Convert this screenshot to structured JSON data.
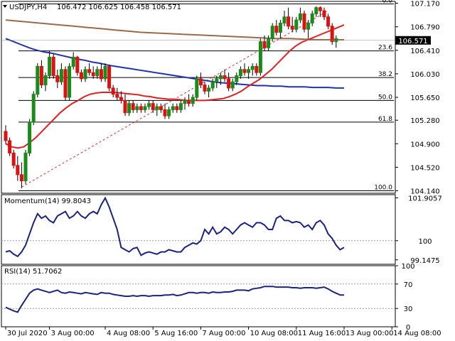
{
  "header": {
    "collapse_icon": "triangle-down-icon",
    "symbol": "USDJPY,H4",
    "ohlc": "106.472 106.625 106.458 106.571"
  },
  "colors": {
    "bull": "#1a8a1a",
    "bear": "#dd1111",
    "wick": "#000000",
    "sma_fast": "#dd2222",
    "sma_slow": "#2233aa",
    "sma_long": "#9a6a4a",
    "fib": "#000000",
    "trend": "#dd3333",
    "indicator": "#1a237e",
    "price_tag_bg": "#000000",
    "price_tag_text": "#ffffff"
  },
  "chart_data": [
    {
      "type": "candlestick",
      "title": "USDJPY,H4",
      "ylim": [
        104.1,
        107.2
      ],
      "yticks": [
        107.17,
        106.79,
        106.41,
        106.03,
        105.65,
        105.28,
        104.9,
        104.52,
        104.14
      ],
      "current_price": 106.571,
      "xticks": [
        {
          "label": "30 Jul 2020",
          "index": 0
        },
        {
          "label": "3 Aug 00:00",
          "index": 11
        },
        {
          "label": "4 Aug 08:00",
          "index": 25
        },
        {
          "label": "5 Aug 16:00",
          "index": 37
        },
        {
          "label": "7 Aug 00:00",
          "index": 49
        },
        {
          "label": "10 Aug 08:00",
          "index": 61
        },
        {
          "label": "11 Aug 16:00",
          "index": 73
        },
        {
          "label": "13 Aug 00:00",
          "index": 85
        },
        {
          "label": "14 Aug 08:00",
          "index": 97
        }
      ],
      "candles": [
        [
          105.1,
          105.2,
          104.9,
          104.95
        ],
        [
          104.95,
          105.0,
          104.7,
          104.75
        ],
        [
          104.75,
          104.8,
          104.5,
          104.55
        ],
        [
          104.55,
          104.7,
          104.3,
          104.4
        ],
        [
          104.4,
          104.6,
          104.18,
          104.3
        ],
        [
          104.3,
          104.8,
          104.25,
          104.75
        ],
        [
          104.75,
          105.3,
          104.7,
          105.25
        ],
        [
          105.25,
          105.75,
          105.2,
          105.7
        ],
        [
          105.7,
          106.2,
          105.65,
          106.15
        ],
        [
          106.15,
          106.25,
          105.8,
          105.85
        ],
        [
          105.85,
          106.05,
          105.75,
          106.0
        ],
        [
          106.0,
          106.4,
          105.95,
          106.3
        ],
        [
          106.3,
          106.35,
          105.95,
          106.0
        ],
        [
          106.0,
          106.1,
          105.8,
          105.9
        ],
        [
          105.9,
          106.2,
          105.85,
          106.1
        ],
        [
          106.1,
          106.15,
          105.6,
          105.65
        ],
        [
          105.65,
          106.2,
          105.6,
          106.15
        ],
        [
          106.15,
          106.38,
          106.1,
          106.3
        ],
        [
          106.3,
          106.32,
          106.0,
          106.05
        ],
        [
          106.05,
          106.1,
          105.9,
          105.95
        ],
        [
          105.95,
          106.15,
          105.9,
          106.1
        ],
        [
          106.1,
          106.2,
          106.0,
          106.05
        ],
        [
          106.05,
          106.15,
          105.95,
          106.0
        ],
        [
          106.0,
          106.15,
          105.95,
          106.1
        ],
        [
          106.1,
          106.2,
          105.9,
          105.95
        ],
        [
          105.95,
          106.2,
          105.9,
          106.15
        ],
        [
          106.15,
          106.18,
          105.75,
          105.8
        ],
        [
          105.8,
          105.85,
          105.65,
          105.7
        ],
        [
          105.7,
          105.8,
          105.6,
          105.65
        ],
        [
          105.65,
          105.75,
          105.55,
          105.6
        ],
        [
          105.6,
          105.7,
          105.35,
          105.4
        ],
        [
          105.4,
          105.6,
          105.35,
          105.55
        ],
        [
          105.55,
          105.6,
          105.4,
          105.45
        ],
        [
          105.45,
          105.55,
          105.4,
          105.5
        ],
        [
          105.5,
          105.55,
          105.4,
          105.45
        ],
        [
          105.45,
          105.55,
          105.4,
          105.5
        ],
        [
          105.5,
          105.6,
          105.45,
          105.55
        ],
        [
          105.55,
          105.6,
          105.4,
          105.45
        ],
        [
          105.45,
          105.55,
          105.35,
          105.5
        ],
        [
          105.5,
          105.55,
          105.4,
          105.45
        ],
        [
          105.45,
          105.55,
          105.3,
          105.35
        ],
        [
          105.35,
          105.5,
          105.3,
          105.45
        ],
        [
          105.45,
          105.55,
          105.4,
          105.5
        ],
        [
          105.5,
          105.55,
          105.4,
          105.45
        ],
        [
          105.45,
          105.6,
          105.4,
          105.55
        ],
        [
          105.55,
          105.65,
          105.45,
          105.6
        ],
        [
          105.6,
          105.7,
          105.5,
          105.55
        ],
        [
          105.55,
          105.7,
          105.5,
          105.65
        ],
        [
          105.65,
          106.0,
          105.6,
          105.95
        ],
        [
          105.95,
          106.05,
          105.8,
          105.85
        ],
        [
          105.85,
          105.9,
          105.7,
          105.75
        ],
        [
          105.75,
          105.85,
          105.65,
          105.8
        ],
        [
          105.8,
          105.95,
          105.75,
          105.9
        ],
        [
          105.9,
          106.0,
          105.8,
          105.95
        ],
        [
          105.95,
          106.05,
          105.85,
          106.0
        ],
        [
          106.0,
          106.1,
          105.9,
          105.95
        ],
        [
          105.95,
          106.05,
          105.75,
          105.8
        ],
        [
          105.8,
          105.95,
          105.75,
          105.9
        ],
        [
          105.9,
          106.05,
          105.85,
          106.0
        ],
        [
          106.0,
          106.15,
          105.95,
          106.1
        ],
        [
          106.1,
          106.2,
          106.0,
          106.05
        ],
        [
          106.05,
          106.15,
          105.95,
          106.1
        ],
        [
          106.1,
          106.2,
          106.0,
          106.15
        ],
        [
          106.15,
          106.2,
          106.0,
          106.05
        ],
        [
          106.05,
          106.6,
          106.0,
          106.55
        ],
        [
          106.55,
          106.65,
          106.4,
          106.45
        ],
        [
          106.45,
          106.65,
          106.4,
          106.6
        ],
        [
          106.6,
          106.85,
          106.55,
          106.8
        ],
        [
          106.8,
          106.9,
          106.65,
          106.7
        ],
        [
          106.7,
          106.9,
          106.6,
          106.85
        ],
        [
          106.85,
          107.05,
          106.8,
          106.95
        ],
        [
          106.95,
          107.1,
          106.75,
          106.8
        ],
        [
          106.8,
          106.95,
          106.7,
          106.75
        ],
        [
          106.75,
          106.95,
          106.7,
          106.9
        ],
        [
          106.9,
          107.1,
          106.85,
          107.0
        ],
        [
          107.0,
          107.05,
          106.7,
          106.75
        ],
        [
          106.75,
          106.9,
          106.6,
          106.85
        ],
        [
          106.85,
          107.05,
          106.8,
          107.0
        ],
        [
          107.0,
          107.12,
          106.95,
          107.1
        ],
        [
          107.1,
          107.12,
          106.95,
          107.05
        ],
        [
          107.05,
          107.1,
          106.9,
          106.95
        ],
        [
          106.95,
          107.0,
          106.75,
          106.8
        ],
        [
          106.8,
          106.85,
          106.5,
          106.55
        ],
        [
          106.55,
          106.65,
          106.45,
          106.6
        ]
      ],
      "sma_fast": [
        104.9,
        104.85,
        104.83,
        104.85,
        104.92,
        105.0,
        105.1,
        105.2,
        105.3,
        105.4,
        105.48,
        105.55,
        105.6,
        105.66,
        105.7,
        105.72,
        105.73,
        105.73,
        105.73,
        105.72,
        105.71,
        105.7,
        105.69,
        105.67,
        105.66,
        105.64,
        105.63,
        105.62,
        105.62,
        105.61,
        105.6,
        105.6,
        105.6,
        105.6,
        105.61,
        105.62,
        105.63,
        105.66,
        105.7,
        105.75,
        105.82,
        105.88,
        105.94,
        106.02,
        106.1,
        106.2,
        106.3,
        106.4,
        106.48,
        106.54,
        106.58,
        106.62,
        106.66,
        106.7,
        106.74,
        106.78,
        106.82
      ],
      "sma_slow": [
        106.6,
        106.55,
        106.5,
        106.45,
        106.41,
        106.38,
        106.36,
        106.33,
        106.3,
        106.27,
        106.25,
        106.22,
        106.2,
        106.17,
        106.15,
        106.13,
        106.11,
        106.09,
        106.07,
        106.05,
        106.03,
        106.01,
        105.99,
        105.97,
        105.95,
        105.93,
        105.91,
        105.89,
        105.88,
        105.87,
        105.86,
        105.85,
        105.84,
        105.84,
        105.83,
        105.83,
        105.82,
        105.82,
        105.82,
        105.81,
        105.81,
        105.81,
        105.8,
        105.8
      ],
      "sma_long": [
        106.9,
        106.88,
        106.86,
        106.84,
        106.82,
        106.8,
        106.78,
        106.76,
        106.74,
        106.72,
        106.7,
        106.69,
        106.68,
        106.67,
        106.66,
        106.65,
        106.64,
        106.63,
        106.62,
        106.61,
        106.6,
        106.6,
        106.59,
        106.58,
        106.58,
        106.58
      ],
      "trendline": [
        [
          4,
          104.2
        ],
        [
          81,
          107.05
        ]
      ],
      "fibonacci": [
        {
          "label": "0.0",
          "price": 107.16
        },
        {
          "label": "23.6",
          "price": 106.4
        },
        {
          "label": "38.2",
          "price": 105.97
        },
        {
          "label": "50.0",
          "price": 105.6
        },
        {
          "label": "61.8",
          "price": 105.25
        },
        {
          "label": "100.0",
          "price": 104.14
        }
      ]
    },
    {
      "type": "line",
      "title": "Momentum(14) 99.8043",
      "ylim": [
        98.95,
        102.05
      ],
      "yticks": [
        101.9057,
        100,
        99.1475
      ],
      "reference_line": 100,
      "values": [
        99.5,
        99.55,
        99.4,
        99.3,
        99.5,
        99.8,
        100.3,
        100.8,
        101.2,
        101.0,
        101.1,
        100.9,
        100.8,
        101.1,
        101.2,
        101.3,
        101.0,
        101.1,
        101.3,
        101.1,
        101.0,
        101.2,
        101.3,
        101.2,
        101.6,
        101.9,
        101.5,
        101.0,
        100.5,
        99.7,
        99.6,
        99.5,
        99.65,
        99.7,
        99.35,
        99.45,
        99.5,
        99.45,
        99.4,
        99.5,
        99.5,
        99.6,
        99.55,
        99.5,
        99.5,
        99.7,
        99.8,
        99.9,
        99.85,
        100.0,
        100.5,
        100.3,
        100.6,
        100.3,
        100.4,
        100.6,
        100.5,
        100.3,
        100.5,
        100.7,
        100.8,
        100.7,
        100.6,
        100.8,
        100.8,
        100.7,
        100.5,
        100.5,
        101.0,
        101.1,
        100.9,
        100.9,
        100.8,
        100.85,
        100.8,
        100.6,
        100.7,
        100.5,
        100.8,
        100.9,
        100.7,
        100.3,
        100.1,
        99.8,
        99.6,
        99.7
      ]
    },
    {
      "type": "line",
      "title": "RSI(14) 51.7062",
      "ylim": [
        0,
        100
      ],
      "yticks": [
        100,
        70,
        30,
        0
      ],
      "levels": [
        70,
        30
      ],
      "values": [
        32,
        29,
        26,
        24,
        35,
        45,
        55,
        60,
        62,
        60,
        58,
        56,
        58,
        60,
        56,
        55,
        57,
        56,
        55,
        54,
        56,
        55,
        54,
        53,
        56,
        55,
        55,
        53,
        52,
        51,
        50,
        50,
        51,
        50,
        51,
        51,
        50,
        51,
        51,
        51,
        52,
        52,
        53,
        51,
        52,
        54,
        56,
        56,
        55,
        56,
        56,
        55,
        57,
        56,
        56,
        57,
        57,
        58,
        60,
        60,
        60,
        59,
        62,
        63,
        64,
        66,
        66,
        66,
        65,
        65,
        65,
        65,
        64,
        64,
        63,
        64,
        64,
        64,
        63,
        64,
        65,
        62,
        58,
        55,
        52,
        52
      ]
    }
  ]
}
